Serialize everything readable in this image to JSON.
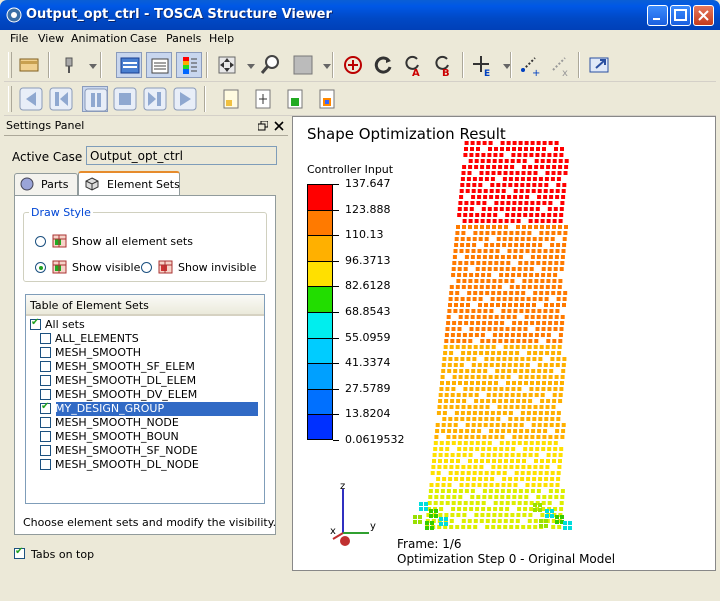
{
  "window": {
    "title": "Output_opt_ctrl - TOSCA Structure Viewer"
  },
  "menu": [
    "File",
    "View",
    "Animation",
    "Case",
    "Panels",
    "Help"
  ],
  "settings_panel": {
    "title": "Settings Panel",
    "active_case_label": "Active Case",
    "active_case_value": "Output_opt_ctrl",
    "tabs": [
      "Parts",
      "Element Sets"
    ],
    "draw_style": {
      "title": "Draw Style",
      "show_all": "Show all element sets",
      "show_visible": "Show visible",
      "show_invisible": "Show invisible"
    },
    "table_title": "Table of Element Sets",
    "sets": [
      {
        "name": "All sets",
        "checked": true
      },
      {
        "name": "ALL_ELEMENTS",
        "checked": false
      },
      {
        "name": "MESH_SMOOTH",
        "checked": false
      },
      {
        "name": "MESH_SMOOTH_SF_ELEM",
        "checked": false
      },
      {
        "name": "MESH_SMOOTH_DL_ELEM",
        "checked": false
      },
      {
        "name": "MESH_SMOOTH_DV_ELEM",
        "checked": false
      },
      {
        "name": "MY_DESIGN_GROUP",
        "checked": true,
        "selected": true
      },
      {
        "name": "MESH_SMOOTH_NODE",
        "checked": false
      },
      {
        "name": "MESH_SMOOTH_BOUN",
        "checked": false
      },
      {
        "name": "MESH_SMOOTH_SF_NODE",
        "checked": false
      },
      {
        "name": "MESH_SMOOTH_DL_NODE",
        "checked": false
      }
    ],
    "hint": "Choose element sets and modify the visibility.",
    "tabs_on_top": "Tabs on top"
  },
  "viewer": {
    "title": "Shape Optimization Result",
    "legend_title": "Controller Input",
    "legend_values": [
      "137.647",
      "123.888",
      "110.13",
      "96.3713",
      "82.6128",
      "68.8543",
      "55.0959",
      "41.3374",
      "27.5789",
      "13.8204",
      "0.0619532"
    ],
    "legend_colors": [
      "#ff0000",
      "#ff7a00",
      "#ffb000",
      "#ffe000",
      "#22dd00",
      "#00eeee",
      "#00ccff",
      "#00a0ff",
      "#0070ff",
      "#0030ff"
    ],
    "axis_labels": [
      "z",
      "y",
      "x"
    ],
    "frame": "Frame: 1/6",
    "step": "Optimization Step  0 - Original Model"
  }
}
